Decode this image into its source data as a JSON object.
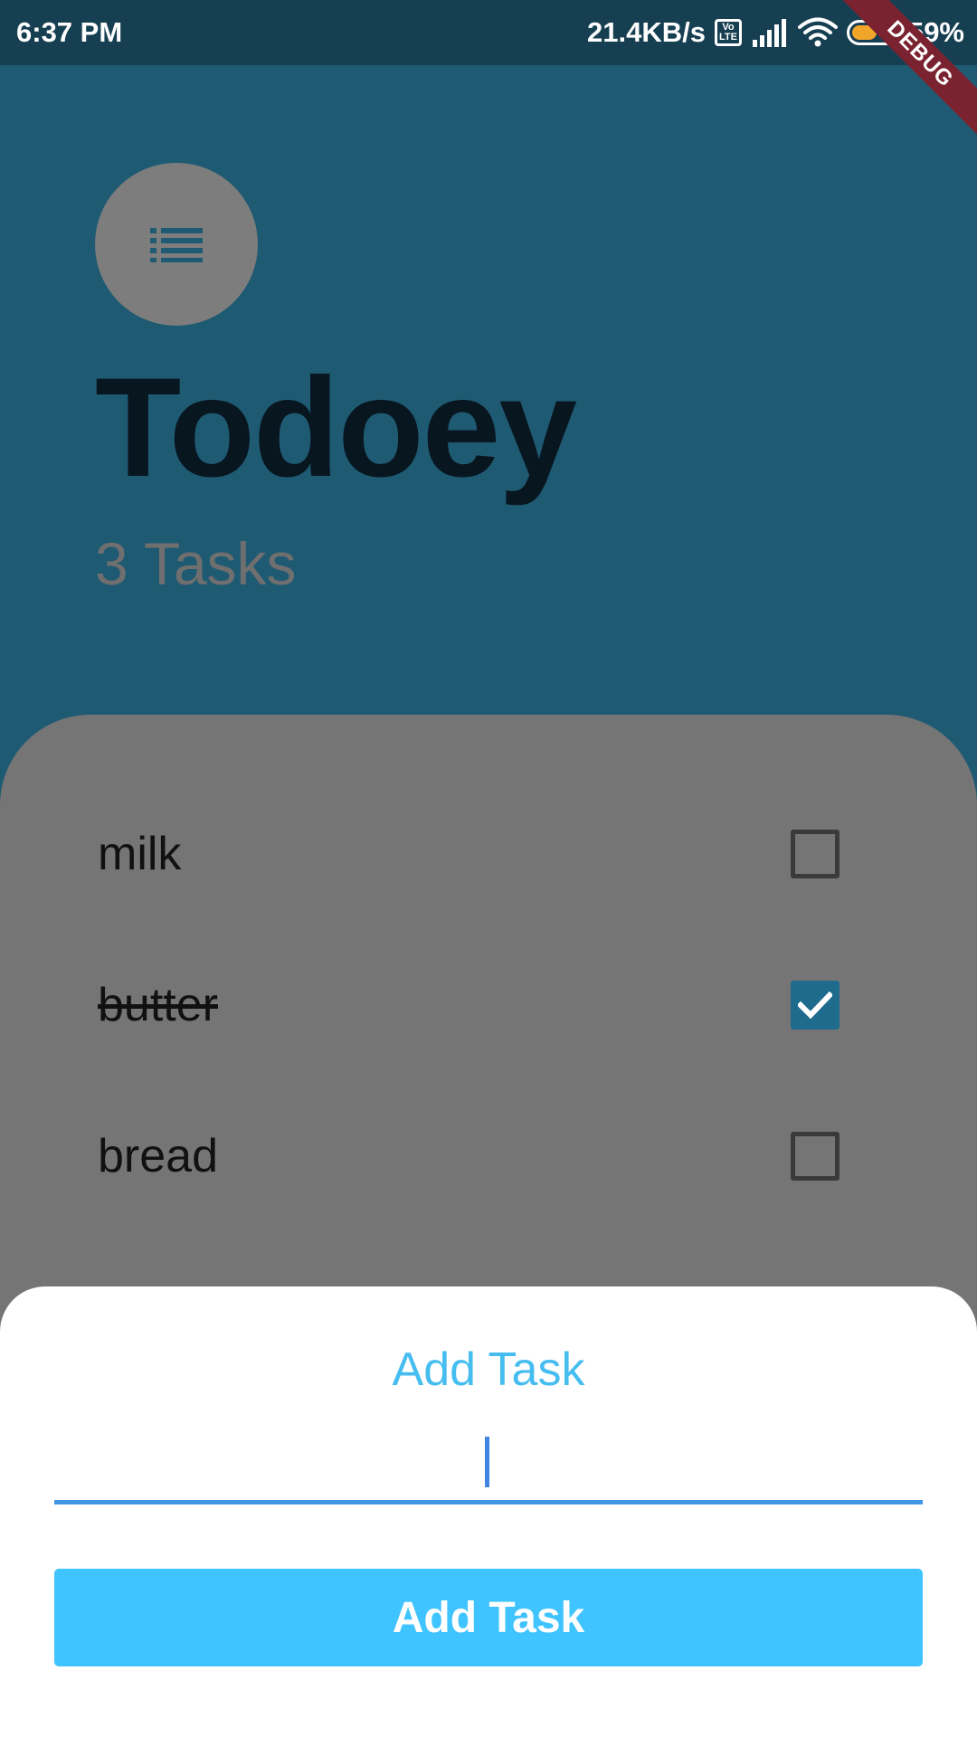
{
  "status_bar": {
    "time": "6:37 PM",
    "network_speed": "21.4KB/s",
    "volte_top": "Vo",
    "volte_bottom": "LTE",
    "battery_percent": "59%",
    "battery_level": 0.59,
    "icons": [
      "volte-icon",
      "signal-icon",
      "wifi-icon",
      "battery-icon"
    ]
  },
  "debug_banner": "DEBUG",
  "header": {
    "icon": "list-icon",
    "title": "Todoey",
    "task_count": "3 Tasks"
  },
  "tasks": [
    {
      "label": "milk",
      "checked": false
    },
    {
      "label": "butter",
      "checked": true
    },
    {
      "label": "bread",
      "checked": false
    }
  ],
  "add_sheet": {
    "title": "Add Task",
    "input_value": "",
    "button_label": "Add Task"
  },
  "colors": {
    "background": "#1f5a73",
    "status_bar": "#173f52",
    "panel": "#757575",
    "accent": "#40c4ff",
    "checkbox_checked": "#1e6b8d",
    "input_underline": "#3f97e3"
  }
}
